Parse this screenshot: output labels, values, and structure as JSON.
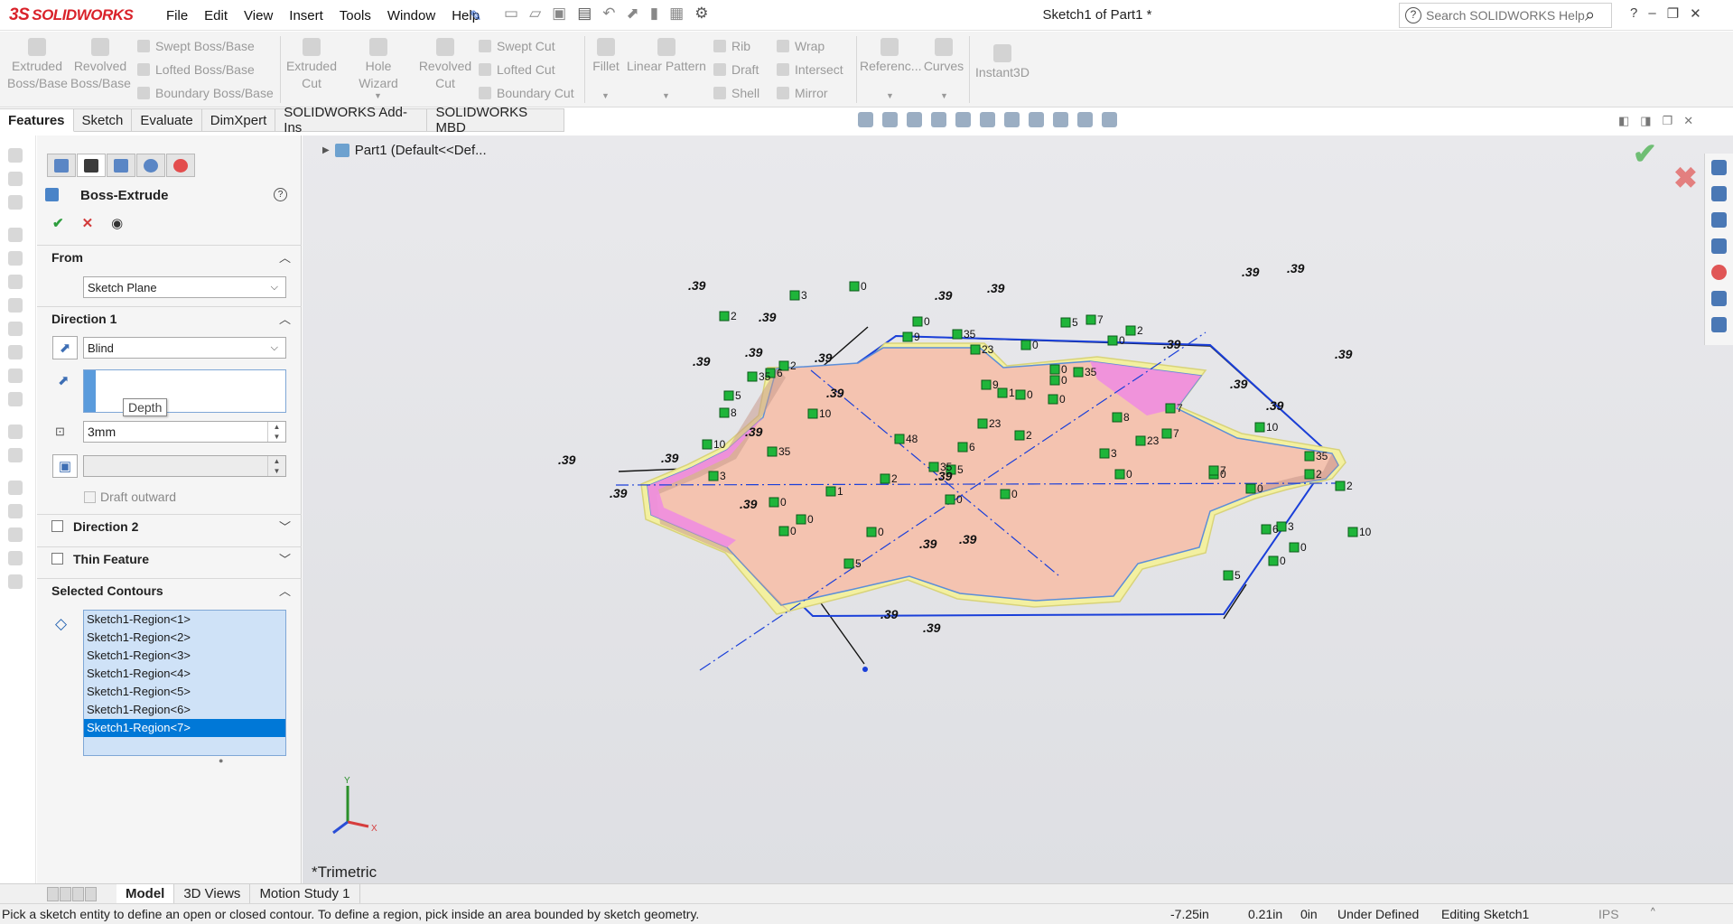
{
  "app": {
    "logo_text": "SOLIDWORKS",
    "logo_mark": "3S",
    "document_title": "Sketch1 of Part1 *"
  },
  "menu": [
    "File",
    "Edit",
    "View",
    "Insert",
    "Tools",
    "Window",
    "Help"
  ],
  "help_search": {
    "placeholder": "Search SOLIDWORKS Help"
  },
  "command_manager": {
    "extruded_boss": [
      "Extruded",
      "Boss/Base"
    ],
    "revolved_boss": [
      "Revolved",
      "Boss/Base"
    ],
    "swept_boss": "Swept Boss/Base",
    "lofted_boss": "Lofted Boss/Base",
    "boundary_boss": "Boundary Boss/Base",
    "extruded_cut": [
      "Extruded",
      "Cut"
    ],
    "hole_wizard": "Hole Wizard",
    "revolved_cut": [
      "Revolved",
      "Cut"
    ],
    "swept_cut": "Swept Cut",
    "lofted_cut": "Lofted Cut",
    "boundary_cut": "Boundary Cut",
    "fillet": "Fillet",
    "linear_pattern": "Linear Pattern",
    "rib": "Rib",
    "wrap": "Wrap",
    "draft": "Draft",
    "intersect": "Intersect",
    "shell": "Shell",
    "mirror": "Mirror",
    "reference": "Referenc...",
    "curves": "Curves",
    "instant3d": "Instant3D"
  },
  "tabs": [
    "Features",
    "Sketch",
    "Evaluate",
    "DimXpert",
    "SOLIDWORKS Add-Ins",
    "SOLIDWORKS MBD"
  ],
  "property_manager": {
    "title": "Boss-Extrude",
    "from": {
      "label": "From",
      "value": "Sketch Plane"
    },
    "direction1": {
      "label": "Direction 1",
      "end_condition": "Blind",
      "depth": "3mm",
      "tooltip": "Depth",
      "draft_outward": "Draft outward"
    },
    "direction2": {
      "label": "Direction 2"
    },
    "thin_feature": {
      "label": "Thin Feature"
    },
    "selected_contours": {
      "label": "Selected Contours",
      "items": [
        "Sketch1-Region<1>",
        "Sketch1-Region<2>",
        "Sketch1-Region<3>",
        "Sketch1-Region<4>",
        "Sketch1-Region<5>",
        "Sketch1-Region<6>",
        "Sketch1-Region<7>"
      ],
      "selected_index": 6
    }
  },
  "viewport": {
    "tree_flyout": "Part1  (Default<<Def...",
    "view_label": "*Trimetric",
    "dimension_value": ".39",
    "relation_labels": [
      "0",
      "3",
      "2",
      "10",
      "5",
      "35",
      "23",
      "7",
      "6",
      "8",
      "9",
      "48",
      "1"
    ]
  },
  "bottom_tabs": [
    "Model",
    "3D Views",
    "Motion Study 1"
  ],
  "status": {
    "message": "Pick a sketch entity to define an open or closed contour. To define a region, pick inside an area bounded by sketch geometry.",
    "x": "-7.25in",
    "y": "0.21in",
    "z": "0in",
    "state": "Under Defined",
    "editing": "Editing Sketch1",
    "units": "IPS"
  },
  "colors": {
    "accent": "#0078d7",
    "brand": "#d9222a",
    "face_pink": "#f4c3b0",
    "selected_face": "#f08ee0",
    "relation_green": "#1fb53a",
    "sketch_blue": "#1a3fd9"
  }
}
